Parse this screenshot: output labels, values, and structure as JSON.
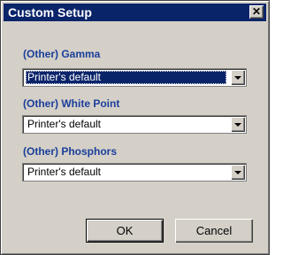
{
  "window": {
    "title": "Custom Setup",
    "close_glyph": "✕"
  },
  "groups": [
    {
      "label": "(Other) Gamma",
      "value": "Printer's default",
      "focused": true
    },
    {
      "label": "(Other) White Point",
      "value": "Printer's default",
      "focused": false
    },
    {
      "label": "(Other) Phosphors",
      "value": "Printer's default",
      "focused": false
    }
  ],
  "buttons": {
    "ok": "OK",
    "cancel": "Cancel"
  },
  "colors": {
    "titlebar": "#0a246a",
    "label": "#1a3e9a",
    "face": "#d4d0c8"
  }
}
